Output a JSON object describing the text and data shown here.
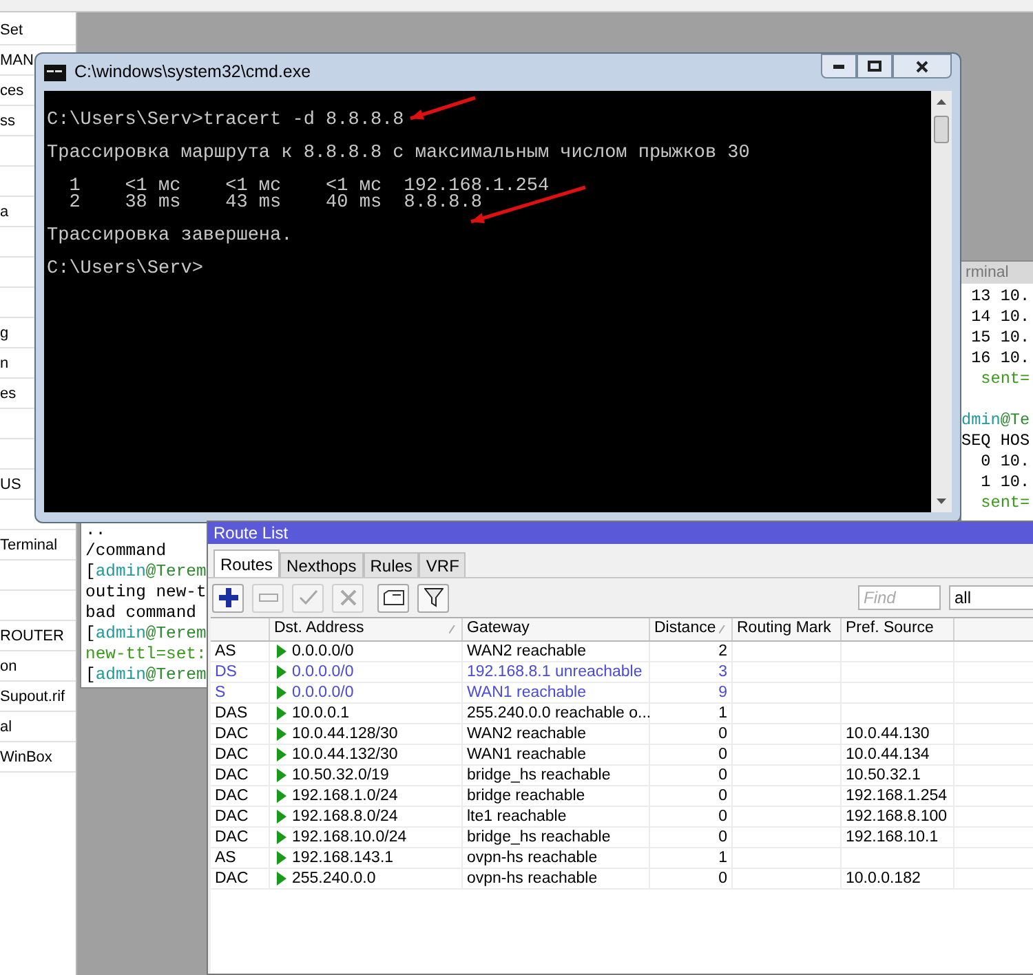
{
  "sidebar": {
    "items": [
      {
        "kind": "text",
        "label": "Set"
      },
      {
        "kind": "text",
        "label": "MAN"
      },
      {
        "kind": "text",
        "label": "ces"
      },
      {
        "kind": "text",
        "label": "ss"
      },
      {
        "kind": "covered"
      },
      {
        "kind": "covered"
      },
      {
        "kind": "text",
        "label": "a"
      },
      {
        "kind": "covered"
      },
      {
        "kind": "covered"
      },
      {
        "kind": "covered"
      },
      {
        "kind": "text",
        "label": "g"
      },
      {
        "kind": "text",
        "label": "n"
      },
      {
        "kind": "text",
        "label": "es"
      },
      {
        "kind": "covered"
      },
      {
        "kind": "covered"
      },
      {
        "kind": "text",
        "label": "US"
      },
      {
        "kind": "covered"
      },
      {
        "kind": "text",
        "label": "Terminal"
      },
      {
        "kind": "covered"
      },
      {
        "kind": "covered"
      },
      {
        "kind": "text",
        "label": "ROUTER"
      },
      {
        "kind": "text",
        "label": "on"
      },
      {
        "kind": "text",
        "label": "Supout.rif"
      },
      {
        "kind": "text",
        "label": "al"
      },
      {
        "kind": "text",
        "label": "WinBox"
      }
    ]
  },
  "terminal_right": {
    "title": "rminal",
    "paragraphs": [
      [
        [
          {
            "text": " 13 10.",
            "kind": "plain"
          }
        ],
        [
          {
            "text": " 14 10.",
            "kind": "plain"
          }
        ],
        [
          {
            "text": " 15 10.",
            "kind": "plain"
          }
        ],
        [
          {
            "text": " 16 10.",
            "kind": "plain"
          }
        ],
        [
          {
            "text": "  sent=",
            "kind": "green"
          }
        ]
      ],
      [
        [
          {
            "text": "dmin",
            "kind": "user"
          },
          {
            "text": "@Te",
            "kind": "host"
          }
        ],
        [
          {
            "text": "SEQ HOS",
            "kind": "plain"
          }
        ],
        [
          {
            "text": "  0 10.",
            "kind": "plain"
          }
        ],
        [
          {
            "text": "  1 10.",
            "kind": "plain"
          }
        ],
        [
          {
            "text": "  sent=",
            "kind": "green"
          }
        ]
      ]
    ]
  },
  "terminal_left": {
    "lines": [
      [
        {
          "text": "..",
          "kind": "plain"
        }
      ],
      [
        {
          "text": "/command",
          "kind": "plain"
        }
      ],
      [
        {
          "text": "[",
          "kind": "plain"
        },
        {
          "text": "admin",
          "kind": "user"
        },
        {
          "text": "@Terem",
          "kind": "host"
        }
      ],
      [
        {
          "text": "outing new-t",
          "kind": "plain"
        }
      ],
      [
        {
          "text": "bad command",
          "kind": "plain"
        }
      ],
      [
        {
          "text": "[",
          "kind": "plain"
        },
        {
          "text": "admin",
          "kind": "user"
        },
        {
          "text": "@Terem",
          "kind": "host"
        }
      ],
      [
        {
          "text": "new-ttl=set:",
          "kind": "green"
        }
      ],
      [
        {
          "text": "[",
          "kind": "plain"
        },
        {
          "text": "admin",
          "kind": "user"
        },
        {
          "text": "@Terem",
          "kind": "host"
        }
      ]
    ]
  },
  "cmd_window": {
    "title": "C:\\windows\\system32\\cmd.exe",
    "paragraphs": [
      [
        "C:\\Users\\Serv>tracert -d 8.8.8.8"
      ],
      [
        "Трассировка маршрута к 8.8.8.8 с максимальным числом прыжков 30"
      ],
      [
        "  1    <1 мс    <1 мс    <1 мс  192.168.1.254",
        "  2    38 ms    43 ms    40 ms  8.8.8.8"
      ],
      [
        "Трассировка завершена."
      ],
      [
        "C:\\Users\\Serv>"
      ]
    ]
  },
  "route_list": {
    "title": "Route List",
    "tabs": [
      {
        "label": "Routes",
        "selected": true
      },
      {
        "label": "Nexthops",
        "selected": false
      },
      {
        "label": "Rules",
        "selected": false
      },
      {
        "label": "VRF",
        "selected": false
      }
    ],
    "toolbar": [
      {
        "kind": "add",
        "disabled": false
      },
      {
        "kind": "remove",
        "disabled": true
      },
      {
        "kind": "enable",
        "disabled": true
      },
      {
        "kind": "disable",
        "disabled": true
      },
      {
        "kind": "comment",
        "disabled": false
      },
      {
        "kind": "filter",
        "disabled": false
      }
    ],
    "find": {
      "placeholder": "Find"
    },
    "filter_select": {
      "value": "all"
    },
    "columns": [
      {
        "sorted": false
      },
      {
        "label": "Dst. Address",
        "sorted": true
      },
      {
        "label": "Gateway",
        "sorted": false
      },
      {
        "label": "Distance",
        "sorted": true
      },
      {
        "label": "Routing Mark",
        "sorted": false
      },
      {
        "label": "Pref. Source",
        "sorted": false
      }
    ],
    "rows": [
      {
        "flags": "AS",
        "dst": "0.0.0.0/0",
        "gateway": "WAN2 reachable",
        "distance": "2",
        "active": true
      },
      {
        "flags": "DS",
        "dst": "0.0.0.0/0",
        "gateway": "192.168.8.1 unreachable",
        "distance": "3",
        "active": false
      },
      {
        "flags": "S",
        "dst": "0.0.0.0/0",
        "gateway": "WAN1 reachable",
        "distance": "9",
        "active": false
      },
      {
        "flags": "DAS",
        "dst": "10.0.0.1",
        "gateway": "255.240.0.0 reachable o...",
        "distance": "1",
        "active": true
      },
      {
        "flags": "DAC",
        "dst": "10.0.44.128/30",
        "gateway": "WAN2 reachable",
        "distance": "0",
        "pref_source": "10.0.44.130",
        "active": true
      },
      {
        "flags": "DAC",
        "dst": "10.0.44.132/30",
        "gateway": "WAN1 reachable",
        "distance": "0",
        "pref_source": "10.0.44.134",
        "active": true
      },
      {
        "flags": "DAC",
        "dst": "10.50.32.0/19",
        "gateway": "bridge_hs reachable",
        "distance": "0",
        "pref_source": "10.50.32.1",
        "active": true
      },
      {
        "flags": "DAC",
        "dst": "192.168.1.0/24",
        "gateway": "bridge reachable",
        "distance": "0",
        "pref_source": "192.168.1.254",
        "active": true
      },
      {
        "flags": "DAC",
        "dst": "192.168.8.0/24",
        "gateway": "lte1 reachable",
        "distance": "0",
        "pref_source": "192.168.8.100",
        "active": true
      },
      {
        "flags": "DAC",
        "dst": "192.168.10.0/24",
        "gateway": "bridge_hs reachable",
        "distance": "0",
        "pref_source": "192.168.10.1",
        "active": true
      },
      {
        "flags": "AS",
        "dst": "192.168.143.1",
        "gateway": "ovpn-hs reachable",
        "distance": "1",
        "active": true
      },
      {
        "flags": "DAC",
        "dst": "255.240.0.0",
        "gateway": "ovpn-hs reachable",
        "distance": "0",
        "pref_source": "10.0.0.182",
        "active": true
      }
    ]
  }
}
